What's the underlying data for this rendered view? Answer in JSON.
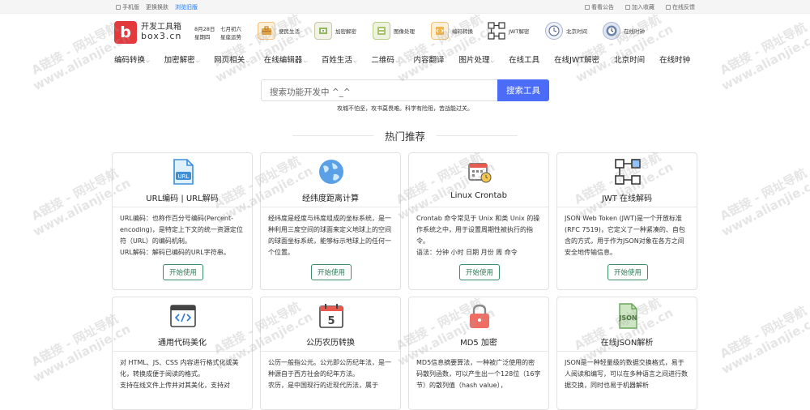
{
  "topbar": {
    "mobile": "手机版",
    "skin": "更换换肤",
    "old": "浏览旧版",
    "notice": "看看公告",
    "favorite": "加入收藏",
    "feedback": "在线反馈"
  },
  "logo": {
    "mark": "b",
    "name": "开发工具箱",
    "domain": "box3.cn"
  },
  "date": {
    "day": "8月28日",
    "weekday": "星期四",
    "lunar": "七月初六",
    "fortune": "星座运势"
  },
  "quick": [
    {
      "label": "便民生活",
      "icon": "toolbox-icon"
    },
    {
      "label": "加密解密",
      "icon": "lock-icon"
    },
    {
      "label": "图像处理",
      "icon": "image-icon"
    },
    {
      "label": "编码转换",
      "icon": "code-icon"
    },
    {
      "label": "JWT解密",
      "icon": "jwt-icon"
    },
    {
      "label": "北京时间",
      "icon": "clock-icon"
    },
    {
      "label": "在线时钟",
      "icon": "world-clock-icon"
    }
  ],
  "nav": [
    {
      "label": "编码转换",
      "caret": "⌵"
    },
    {
      "label": "加密解密",
      "caret": "⌵"
    },
    {
      "label": "网页相关",
      "caret": "⌵"
    },
    {
      "label": "在线编辑器",
      "caret": "⌵"
    },
    {
      "label": "百姓生活",
      "caret": "⌵"
    },
    {
      "label": "二维码",
      "caret": "⌵"
    },
    {
      "label": "内容翻译",
      "caret": ""
    },
    {
      "label": "图片处理",
      "caret": "⌵"
    },
    {
      "label": "在线工具",
      "caret": ""
    },
    {
      "label": "在线JWT解密",
      "caret": ""
    },
    {
      "label": "北京时间",
      "caret": ""
    },
    {
      "label": "在线时钟",
      "caret": ""
    }
  ],
  "search": {
    "placeholder": "搜索功能开发中 ^_^",
    "button": "搜索工具",
    "slogan": "攻城不怕坚，攻书莫畏难。科学有险阻，苦战能过关。"
  },
  "hot": {
    "title": "热门推荐"
  },
  "cards": [
    {
      "title": "URL编码 | URL解码",
      "icon": "url-file-icon",
      "desc": "URL编码：也称作百分号编码(Percent-encoding)，是特定上下文的统一资源定位符（URL）的编码机制。\nURL解码：解码已编码的URL字符串。",
      "action": "开始使用"
    },
    {
      "title": "经纬度距离计算",
      "icon": "globe-icon",
      "desc": "经纬度是经度与纬度组成的坐标系统，是一种利用三度空间的球面来定义地球上的空间的球面坐标系统，能够标示地球上的任何一个位置。",
      "action": "开始使用"
    },
    {
      "title": "Linux Crontab",
      "icon": "calendar-clock-icon",
      "desc": "Crontab 命令常见于 Unix 和类 Unix 的操作系统之中，用于设置周期性被执行的指令。\n语法：分钟 小时 日期 月份 周 命令",
      "action": "开始使用"
    },
    {
      "title": "JWT 在线解码",
      "icon": "jwt-icon",
      "desc": "JSON Web Token (JWT)是一个开放标准(RFC 7519)，它定义了一种紧凑的、自包含的方式，用于作为JSON对象在各方之间安全地传输信息。",
      "action": "开始使用"
    },
    {
      "title": "通用代码美化",
      "icon": "code-window-icon",
      "desc": "对 HTML、JS、CSS 内容进行格式化或美化，转换成便于阅读的格式。\n支持在线文件上传并对其美化，支持对",
      "action": ""
    },
    {
      "title": "公历农历转换",
      "icon": "calendar-icon",
      "desc": "公历一般指公元。公元即公历纪年法，是一种源自于西方社会的纪年方法。\n农历，是中国现行的近现代历法，属于",
      "action": ""
    },
    {
      "title": "MD5 加密",
      "icon": "padlock-icon",
      "desc": "MD5信息摘要算法，一种被广泛使用的密码散列函数，可以产生出一个128位（16字节）的散列值（hash value），",
      "action": ""
    },
    {
      "title": "在线JSON解析",
      "icon": "json-file-icon",
      "desc": "JSON是一种轻量级的数据交换格式，易于人阅读和编写，可以在多种语言之间进行数据交换，同时也易于机器解析",
      "action": ""
    }
  ],
  "watermarks": {
    "line1": "A链接 - 网址导航",
    "line2": "www.alianjie.cn"
  }
}
